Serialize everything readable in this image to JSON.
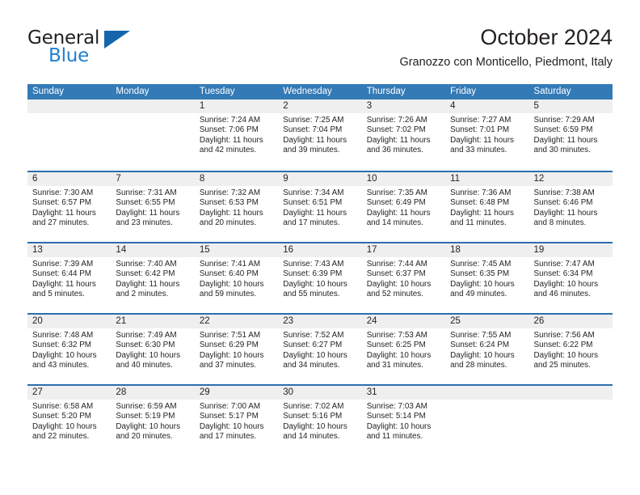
{
  "brand": {
    "name_part1": "General",
    "name_part2": "Blue",
    "logo_icon": "triangle-icon"
  },
  "header": {
    "title": "October 2024",
    "subtitle": "Granozzo con Monticello, Piedmont, Italy"
  },
  "colors": {
    "header_blue": "#337ab7",
    "row_divider_blue": "#2c6fad",
    "date_band_gray": "#efefef",
    "brand_blue": "#1f7fd0",
    "text": "#231f20"
  },
  "weekdays": [
    "Sunday",
    "Monday",
    "Tuesday",
    "Wednesday",
    "Thursday",
    "Friday",
    "Saturday"
  ],
  "weeks": [
    [
      {
        "date": "",
        "lines": []
      },
      {
        "date": "",
        "lines": []
      },
      {
        "date": "1",
        "lines": [
          "Sunrise: 7:24 AM",
          "Sunset: 7:06 PM",
          "Daylight: 11 hours",
          "and 42 minutes."
        ]
      },
      {
        "date": "2",
        "lines": [
          "Sunrise: 7:25 AM",
          "Sunset: 7:04 PM",
          "Daylight: 11 hours",
          "and 39 minutes."
        ]
      },
      {
        "date": "3",
        "lines": [
          "Sunrise: 7:26 AM",
          "Sunset: 7:02 PM",
          "Daylight: 11 hours",
          "and 36 minutes."
        ]
      },
      {
        "date": "4",
        "lines": [
          "Sunrise: 7:27 AM",
          "Sunset: 7:01 PM",
          "Daylight: 11 hours",
          "and 33 minutes."
        ]
      },
      {
        "date": "5",
        "lines": [
          "Sunrise: 7:29 AM",
          "Sunset: 6:59 PM",
          "Daylight: 11 hours",
          "and 30 minutes."
        ]
      }
    ],
    [
      {
        "date": "6",
        "lines": [
          "Sunrise: 7:30 AM",
          "Sunset: 6:57 PM",
          "Daylight: 11 hours",
          "and 27 minutes."
        ]
      },
      {
        "date": "7",
        "lines": [
          "Sunrise: 7:31 AM",
          "Sunset: 6:55 PM",
          "Daylight: 11 hours",
          "and 23 minutes."
        ]
      },
      {
        "date": "8",
        "lines": [
          "Sunrise: 7:32 AM",
          "Sunset: 6:53 PM",
          "Daylight: 11 hours",
          "and 20 minutes."
        ]
      },
      {
        "date": "9",
        "lines": [
          "Sunrise: 7:34 AM",
          "Sunset: 6:51 PM",
          "Daylight: 11 hours",
          "and 17 minutes."
        ]
      },
      {
        "date": "10",
        "lines": [
          "Sunrise: 7:35 AM",
          "Sunset: 6:49 PM",
          "Daylight: 11 hours",
          "and 14 minutes."
        ]
      },
      {
        "date": "11",
        "lines": [
          "Sunrise: 7:36 AM",
          "Sunset: 6:48 PM",
          "Daylight: 11 hours",
          "and 11 minutes."
        ]
      },
      {
        "date": "12",
        "lines": [
          "Sunrise: 7:38 AM",
          "Sunset: 6:46 PM",
          "Daylight: 11 hours",
          "and 8 minutes."
        ]
      }
    ],
    [
      {
        "date": "13",
        "lines": [
          "Sunrise: 7:39 AM",
          "Sunset: 6:44 PM",
          "Daylight: 11 hours",
          "and 5 minutes."
        ]
      },
      {
        "date": "14",
        "lines": [
          "Sunrise: 7:40 AM",
          "Sunset: 6:42 PM",
          "Daylight: 11 hours",
          "and 2 minutes."
        ]
      },
      {
        "date": "15",
        "lines": [
          "Sunrise: 7:41 AM",
          "Sunset: 6:40 PM",
          "Daylight: 10 hours",
          "and 59 minutes."
        ]
      },
      {
        "date": "16",
        "lines": [
          "Sunrise: 7:43 AM",
          "Sunset: 6:39 PM",
          "Daylight: 10 hours",
          "and 55 minutes."
        ]
      },
      {
        "date": "17",
        "lines": [
          "Sunrise: 7:44 AM",
          "Sunset: 6:37 PM",
          "Daylight: 10 hours",
          "and 52 minutes."
        ]
      },
      {
        "date": "18",
        "lines": [
          "Sunrise: 7:45 AM",
          "Sunset: 6:35 PM",
          "Daylight: 10 hours",
          "and 49 minutes."
        ]
      },
      {
        "date": "19",
        "lines": [
          "Sunrise: 7:47 AM",
          "Sunset: 6:34 PM",
          "Daylight: 10 hours",
          "and 46 minutes."
        ]
      }
    ],
    [
      {
        "date": "20",
        "lines": [
          "Sunrise: 7:48 AM",
          "Sunset: 6:32 PM",
          "Daylight: 10 hours",
          "and 43 minutes."
        ]
      },
      {
        "date": "21",
        "lines": [
          "Sunrise: 7:49 AM",
          "Sunset: 6:30 PM",
          "Daylight: 10 hours",
          "and 40 minutes."
        ]
      },
      {
        "date": "22",
        "lines": [
          "Sunrise: 7:51 AM",
          "Sunset: 6:29 PM",
          "Daylight: 10 hours",
          "and 37 minutes."
        ]
      },
      {
        "date": "23",
        "lines": [
          "Sunrise: 7:52 AM",
          "Sunset: 6:27 PM",
          "Daylight: 10 hours",
          "and 34 minutes."
        ]
      },
      {
        "date": "24",
        "lines": [
          "Sunrise: 7:53 AM",
          "Sunset: 6:25 PM",
          "Daylight: 10 hours",
          "and 31 minutes."
        ]
      },
      {
        "date": "25",
        "lines": [
          "Sunrise: 7:55 AM",
          "Sunset: 6:24 PM",
          "Daylight: 10 hours",
          "and 28 minutes."
        ]
      },
      {
        "date": "26",
        "lines": [
          "Sunrise: 7:56 AM",
          "Sunset: 6:22 PM",
          "Daylight: 10 hours",
          "and 25 minutes."
        ]
      }
    ],
    [
      {
        "date": "27",
        "lines": [
          "Sunrise: 6:58 AM",
          "Sunset: 5:20 PM",
          "Daylight: 10 hours",
          "and 22 minutes."
        ]
      },
      {
        "date": "28",
        "lines": [
          "Sunrise: 6:59 AM",
          "Sunset: 5:19 PM",
          "Daylight: 10 hours",
          "and 20 minutes."
        ]
      },
      {
        "date": "29",
        "lines": [
          "Sunrise: 7:00 AM",
          "Sunset: 5:17 PM",
          "Daylight: 10 hours",
          "and 17 minutes."
        ]
      },
      {
        "date": "30",
        "lines": [
          "Sunrise: 7:02 AM",
          "Sunset: 5:16 PM",
          "Daylight: 10 hours",
          "and 14 minutes."
        ]
      },
      {
        "date": "31",
        "lines": [
          "Sunrise: 7:03 AM",
          "Sunset: 5:14 PM",
          "Daylight: 10 hours",
          "and 11 minutes."
        ]
      },
      {
        "date": "",
        "lines": []
      },
      {
        "date": "",
        "lines": []
      }
    ]
  ]
}
